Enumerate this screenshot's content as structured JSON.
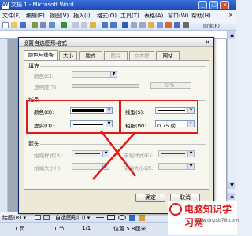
{
  "window": {
    "title": "文档 1 - Microsoft Word",
    "controls": [
      "_",
      "□",
      "×"
    ]
  },
  "menubar": {
    "items": [
      "文件(F)",
      "编辑(E)",
      "视图(V)",
      "插入(I)",
      "格式(O)",
      "工具(T)",
      "表格(A)",
      "窗口(W)",
      "帮助(H)"
    ],
    "help_close": "×"
  },
  "toolbar": {
    "reading_mode": "阅读(R)"
  },
  "dialog": {
    "title": "设置自选图形格式",
    "close": "×",
    "tabs": [
      {
        "label": "颜色与线条",
        "state": "active"
      },
      {
        "label": "大小",
        "state": "normal"
      },
      {
        "label": "版式",
        "state": "normal"
      },
      {
        "label": "图片",
        "state": "disabled"
      },
      {
        "label": "文本框",
        "state": "disabled"
      },
      {
        "label": "网站",
        "state": "normal"
      }
    ],
    "fill": {
      "section": "填充",
      "color_label": "颜色(C):",
      "transparency_label": "透明度(T):",
      "transparency_value": "0 %"
    },
    "line": {
      "section": "线条",
      "color_label": "颜色(O):",
      "dash_label": "虚实(D):",
      "style_label": "线型(S):",
      "weight_label": "粗细(W):",
      "weight_value": "0.75 磅"
    },
    "arrows": {
      "section": "箭头",
      "begin_style_label": "始端样式(B):",
      "begin_size_label": "始端大小(I):",
      "end_style_label": "末端样式(E):",
      "end_size_label": "末端大小(Z):"
    },
    "buttons": {
      "ok": "确定",
      "cancel": "取消"
    }
  },
  "draw_toolbar": {
    "draw_label": "绘图(R) ▾",
    "autoshapes_label": "自选图形(U) ▾"
  },
  "status_bar": {
    "page": "1 页",
    "section": "1 节",
    "page_of": "1/1",
    "position": "位置 5.8厘米"
  },
  "watermark": {
    "brand": "电脑知识学习网",
    "url": "www.dnzsb78.com"
  },
  "colors": {
    "titlebar": "#1c48b6",
    "callout_red": "#e01919",
    "dialog_bg": "#ece9d8"
  }
}
